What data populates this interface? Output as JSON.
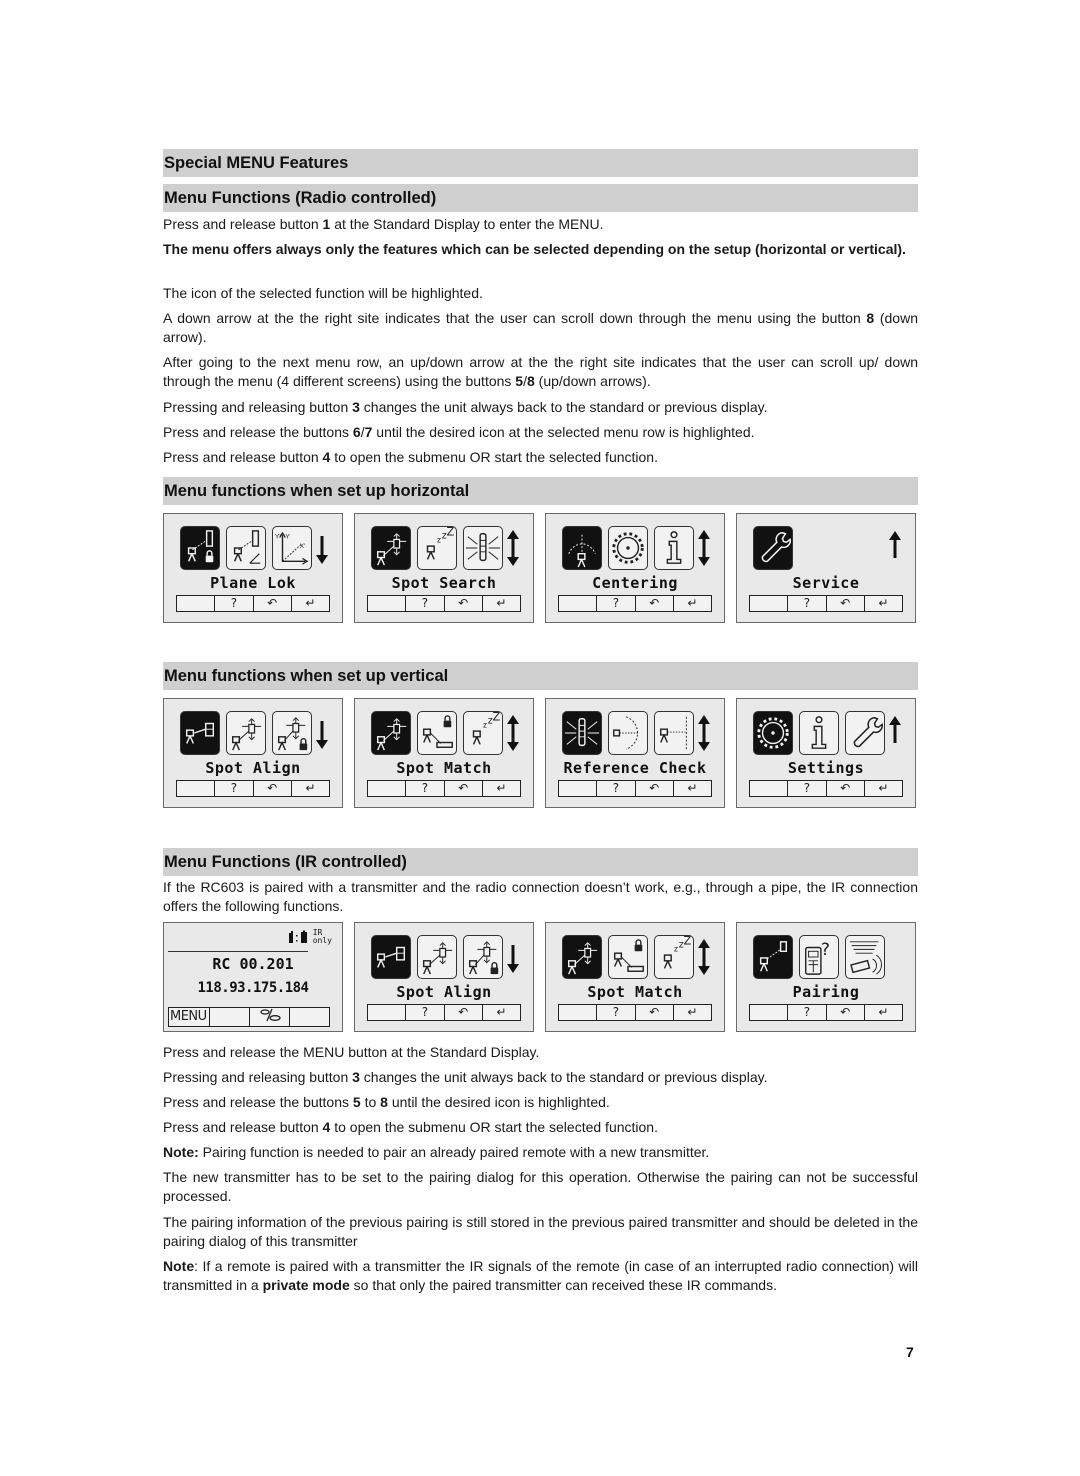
{
  "headings": {
    "special": "Special MENU Features",
    "radio": "Menu Functions (Radio controlled)",
    "horizontal": "Menu functions when set up horizontal",
    "vertical": "Menu functions when set up vertical",
    "ir": "Menu Functions (IR controlled)"
  },
  "radio_paragraphs": {
    "p1_a": "Press and release button ",
    "p1_b": "1",
    "p1_c": " at the Standard Display to enter the MENU.",
    "p2": "The menu offers always only the features which can be selected depending on the setup (horizontal or vertical).",
    "p3": "The icon of the selected function will be highlighted.",
    "p4_a": "A down arrow at the the right site indicates that the user can scroll  down through the menu using the button ",
    "p4_b": "8",
    "p4_c": " (down arrow).",
    "p5_a": "After going to the next menu row, an up/down arrow at the the right site indicates that the user can scroll up/ down through the menu (4 different screens) using the buttons ",
    "p5_b": "5",
    "p5_sep": "/",
    "p5_c": "8",
    "p5_d": " (up/down arrows).",
    "p6_a": "Pressing and releasing button ",
    "p6_b": "3",
    "p6_c": " changes the unit always back to the standard or previous display.",
    "p7_a": "Press and release the buttons ",
    "p7_b": "6",
    "p7_sep": "/",
    "p7_c": "7",
    "p7_d": " until the desired icon at the selected menu row is highlighted.",
    "p8_a": "Press and release button ",
    "p8_b": "4",
    "p8_c": " to open the submenu OR start the selected function."
  },
  "softkeys": [
    "",
    "?",
    "↶",
    "↵"
  ],
  "horizontal_screens": [
    {
      "label": "Plane Lok",
      "icons": [
        "plane-lok-icon",
        "plane-angle-icon",
        "axis-icon"
      ],
      "scroll": "down"
    },
    {
      "label": "Spot Search",
      "icons": [
        "spot-search-icon",
        "sleep-icon",
        "beacon-icon"
      ],
      "scroll": "updown"
    },
    {
      "label": "Centering",
      "icons": [
        "centering-icon",
        "gear-icon",
        "info-icon"
      ],
      "scroll": "updown"
    },
    {
      "label": "Service",
      "icons": [
        "wrench-icon"
      ],
      "scroll": "up"
    }
  ],
  "vertical_screens": [
    {
      "label": "Spot Align",
      "icons": [
        "spot-align-icon",
        "spot-align-arrows-icon",
        "spot-align-lock-icon"
      ],
      "scroll": "down"
    },
    {
      "label": "Spot Match",
      "icons": [
        "spot-search-icon",
        "spot-match-lock-icon",
        "sleep-icon"
      ],
      "scroll": "updown"
    },
    {
      "label": "Reference Check",
      "icons": [
        "beacon-icon",
        "reference-arc-icon",
        "reference-check-icon"
      ],
      "scroll": "updown"
    },
    {
      "label": "Settings",
      "icons": [
        "gear-icon",
        "info-icon",
        "wrench-icon"
      ],
      "scroll": "up"
    }
  ],
  "ir_intro": "If the RC603 is paired with a transmitter and the radio connection doesn’t work, e.g., through a pipe, the IR connection offers the following functions.",
  "standard_display": {
    "ir_badge_line1": "IR",
    "ir_badge_line2": "only",
    "value1": "RC 00.201",
    "value2": "118.93.175.184",
    "softkeys": [
      "MENU",
      "",
      "⁰⁄ₒ",
      ""
    ]
  },
  "ir_screens": [
    {
      "label": "Spot Align",
      "icons": [
        "spot-align-icon",
        "spot-align-arrows-icon",
        "spot-align-lock-icon"
      ],
      "scroll": "down"
    },
    {
      "label": "Spot Match",
      "icons": [
        "spot-search-icon",
        "spot-match-lock-icon",
        "sleep-icon"
      ],
      "scroll": "updown"
    },
    {
      "label": "Pairing",
      "icons": [
        "pairing-link-icon",
        "pairing-remote-icon",
        "pairing-ir-icon"
      ],
      "scroll": "none"
    }
  ],
  "ir_paragraphs": {
    "q1": "Press and release the MENU button at the Standard Display.",
    "q2_a": "Pressing and releasing button ",
    "q2_b": "3",
    "q2_c": " changes the unit always back to the standard or previous display.",
    "q3_a": "Press and release the buttons ",
    "q3_b": "5",
    "q3_mid": " to ",
    "q3_c": "8",
    "q3_d": " until the desired icon is highlighted.",
    "q4_a": "Press and release button ",
    "q4_b": "4",
    "q4_c": " to open the submenu OR start the selected function.",
    "q5_a": "Note:",
    "q5_b": " Pairing function is needed to pair an already paired remote with a new transmitter.",
    "q6": "The new transmitter has to be set to the pairing dialog for this operation. Otherwise the pairing can not be successful processed.",
    "q7": "The pairing information of the previous pairing is still stored in the previous paired transmitter and should be deleted in the pairing dialog of this transmitter",
    "q8_a": "Note",
    "q8_b": ": If a remote is paired with a transmitter the IR signals of the remote (in case of an interrupted radio connection) will transmitted in a ",
    "q8_c": "private mode",
    "q8_d": " so that only the paired transmitter can received these IR commands."
  },
  "page_number": "7"
}
